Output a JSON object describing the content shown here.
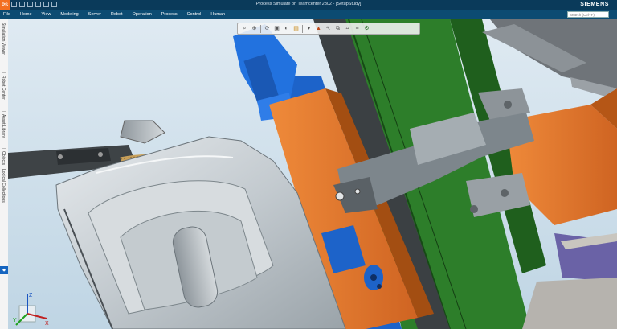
{
  "app": {
    "logo": "PS",
    "title": "Process Simulate on Teamcenter 2302 - [SetupStudy]",
    "brand": "SIEMENS"
  },
  "menu": {
    "items": [
      "File",
      "Home",
      "View",
      "Modeling",
      "Server",
      "Robot",
      "Operation",
      "Process",
      "Control",
      "Human"
    ],
    "search_placeholder": "Search (Ctrl+F)"
  },
  "left_tabs": [
    "Simulation Viewer",
    "Robot Center",
    "Asset Library",
    "Objects",
    "Logical Collections"
  ],
  "left_marker": "◆",
  "toolbar": {
    "icons": [
      "zoom-fit-icon",
      "zoom-icon",
      "rotate-icon",
      "view-cube-icon",
      "shaded-icon",
      "display-mode-icon",
      "selection-icon",
      "pointer-icon",
      "measure-icon",
      "section-icon",
      "snapshot-icon",
      "toggle-icon",
      "robot-icon"
    ]
  },
  "triad": {
    "x": "X",
    "y": "Y",
    "z": "Z"
  },
  "colors": {
    "titlebar": "#0a3a5a",
    "menubar": "#0c4b72",
    "background": "#cfe2ee",
    "fixture_blue": "#1d63c9",
    "orange": "#e2742a",
    "green": "#2d7e2a",
    "metal": "#c9cfd4"
  }
}
